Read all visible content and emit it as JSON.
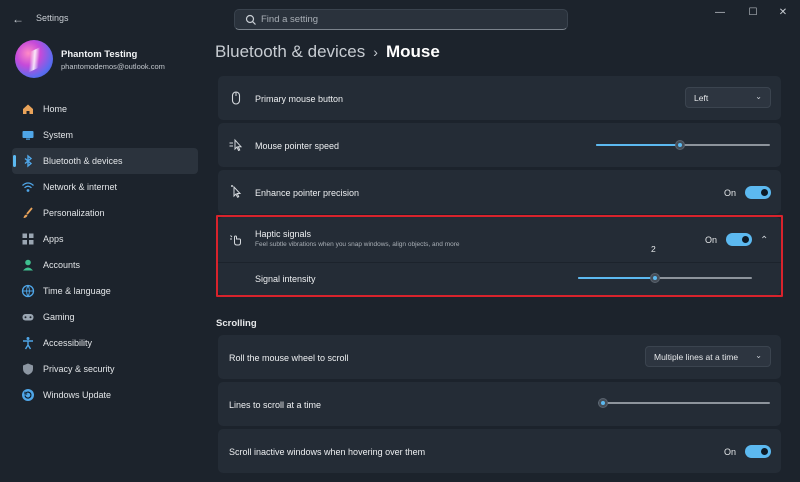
{
  "titlebar": {
    "app_title": "Settings",
    "search_placeholder": "Find a setting",
    "minimize": "—",
    "maximize": "☐",
    "close": "✕",
    "back": "←"
  },
  "profile": {
    "name": "Phantom Testing",
    "email": "phantomodemos@outlook.com"
  },
  "sidebar": {
    "items": [
      {
        "label": "Home",
        "icon": "home-icon",
        "active": false
      },
      {
        "label": "System",
        "icon": "monitor-icon",
        "active": false
      },
      {
        "label": "Bluetooth & devices",
        "icon": "bluetooth-icon",
        "active": true
      },
      {
        "label": "Network & internet",
        "icon": "wifi-icon",
        "active": false
      },
      {
        "label": "Personalization",
        "icon": "brush-icon",
        "active": false
      },
      {
        "label": "Apps",
        "icon": "apps-icon",
        "active": false
      },
      {
        "label": "Accounts",
        "icon": "person-icon",
        "active": false
      },
      {
        "label": "Time & language",
        "icon": "globe-clock-icon",
        "active": false
      },
      {
        "label": "Gaming",
        "icon": "gamepad-icon",
        "active": false
      },
      {
        "label": "Accessibility",
        "icon": "accessibility-icon",
        "active": false
      },
      {
        "label": "Privacy & security",
        "icon": "shield-icon",
        "active": false
      },
      {
        "label": "Windows Update",
        "icon": "update-icon",
        "active": false
      }
    ]
  },
  "breadcrumb": {
    "parent": "Bluetooth & devices",
    "separator": "›",
    "current": "Mouse"
  },
  "settings": {
    "primary_button": {
      "label": "Primary mouse button",
      "value": "Left",
      "icon": "mouse-icon"
    },
    "pointer_speed": {
      "label": "Mouse pointer speed",
      "value_fraction": 0.48,
      "icon": "pointer-speed-icon"
    },
    "enhance_precision": {
      "label": "Enhance pointer precision",
      "state": "On",
      "icon": "pointer-precision-icon"
    },
    "haptic": {
      "label": "Haptic signals",
      "description": "Feel subtle vibrations when you snap windows, align objects, and more",
      "state": "On",
      "icon": "haptic-icon",
      "expand": "⌃"
    },
    "signal_intensity": {
      "label": "Signal intensity",
      "value": "2",
      "value_fraction": 0.44
    }
  },
  "scrolling": {
    "section_title": "Scrolling",
    "roll_wheel": {
      "label": "Roll the mouse wheel to scroll",
      "value": "Multiple lines at a time"
    },
    "lines_to_scroll": {
      "label": "Lines to scroll at a time",
      "value_fraction": 0.03
    },
    "inactive_windows": {
      "label": "Scroll inactive windows when hovering over them",
      "state": "On"
    }
  },
  "colors": {
    "accent": "#5cb9f0",
    "highlight_box": "#d8232c",
    "background": "#1c232c",
    "card": "#242c36"
  }
}
